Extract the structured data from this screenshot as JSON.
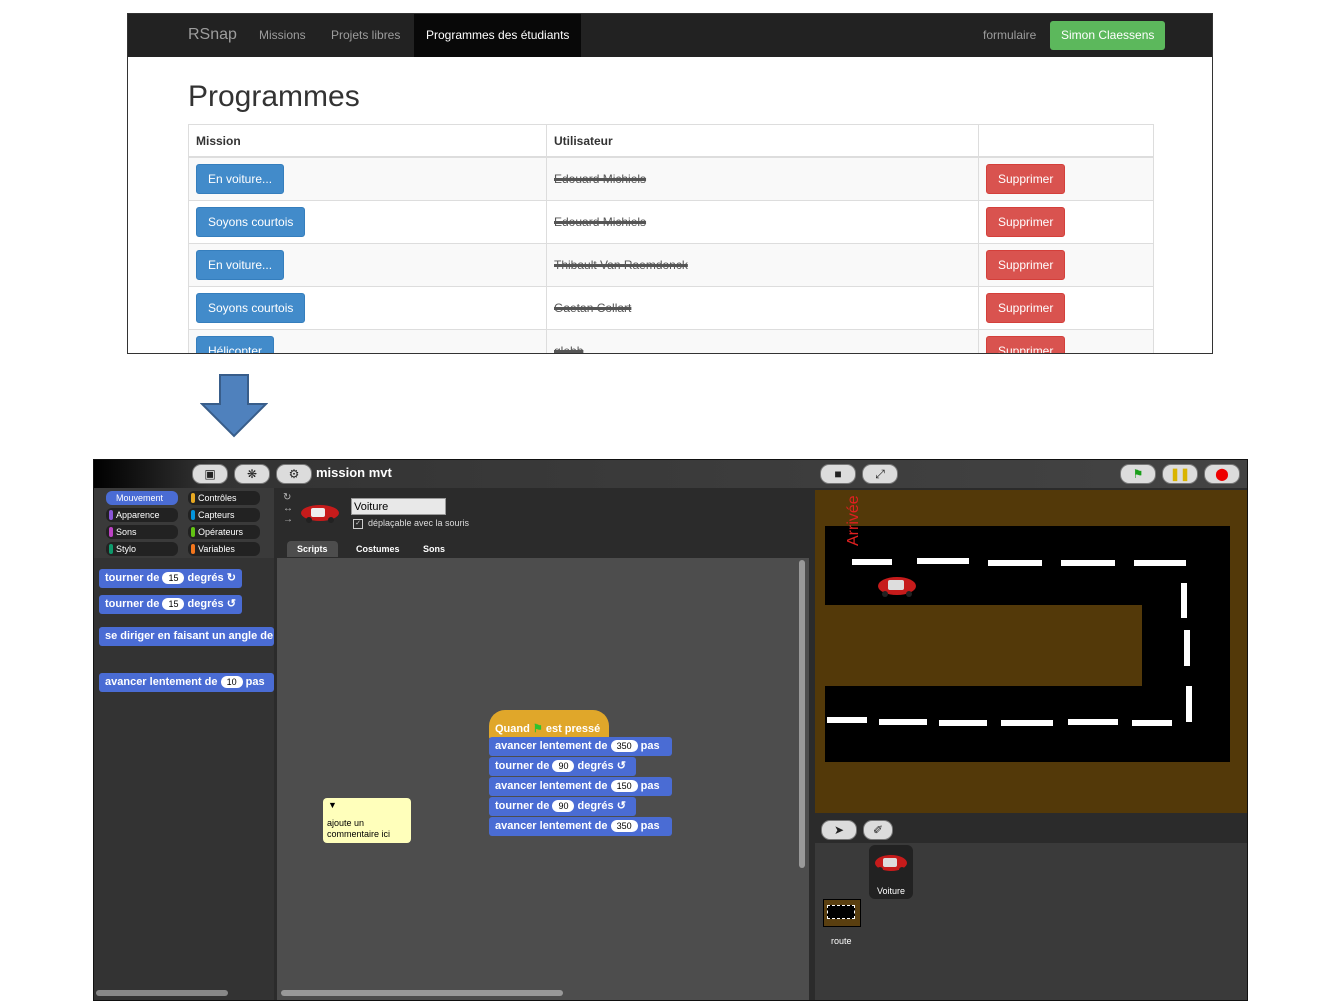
{
  "rsnap": {
    "brand": "RSnap",
    "nav": [
      "Missions",
      "Projets libres",
      "Programmes des étudiants"
    ],
    "right_link": "formulaire",
    "user_button": "Simon Claessens",
    "heading": "Programmes",
    "columns": [
      "Mission",
      "Utilisateur",
      ""
    ],
    "rows": [
      {
        "mission": "En voiture...",
        "user": "Edouard Michiels",
        "action": "Supprimer"
      },
      {
        "mission": "Soyons courtois",
        "user": "Edouard Michiels",
        "action": "Supprimer"
      },
      {
        "mission": "En voiture...",
        "user": "Thibault Van Raemdonck",
        "action": "Supprimer"
      },
      {
        "mission": "Soyons courtois",
        "user": "Gaetan Collart",
        "action": "Supprimer"
      },
      {
        "mission": "Hélicopter",
        "user": "glebb",
        "action": "Supprimer"
      }
    ]
  },
  "snap": {
    "project_title": "mission mvt",
    "categories": [
      "Mouvement",
      "Contrôles",
      "Apparence",
      "Capteurs",
      "Sons",
      "Opérateurs",
      "Stylo",
      "Variables"
    ],
    "category_colors": [
      "#4a6cd4",
      "#e6a822",
      "#8a55d7",
      "#0494dc",
      "#bb42c3",
      "#62c213",
      "#0e9a6c",
      "#f3761d"
    ],
    "palette": {
      "turn_right": {
        "label": "tourner de",
        "value": "15",
        "unit": "degrés"
      },
      "turn_left": {
        "label": "tourner de",
        "value": "15",
        "unit": "degrés"
      },
      "point": "se diriger en faisant un angle de",
      "move_slow": {
        "label": "avancer lentement de",
        "value": "10",
        "unit": "pas"
      }
    },
    "sprite_name": "Voiture",
    "draggable_label": "déplaçable avec la souris",
    "tabs": [
      "Scripts",
      "Costumes",
      "Sons"
    ],
    "hat": {
      "before": "Quand",
      "after": "est pressé"
    },
    "script": [
      {
        "label": "avancer lentement de",
        "value": "350",
        "unit": "pas"
      },
      {
        "label": "tourner de",
        "value": "90",
        "unit": "degrés"
      },
      {
        "label": "avancer lentement de",
        "value": "150",
        "unit": "pas"
      },
      {
        "label": "tourner de",
        "value": "90",
        "unit": "degrés"
      },
      {
        "label": "avancer lentement de",
        "value": "350",
        "unit": "pas"
      }
    ],
    "comment": "ajoute un commentaire ici",
    "stage_text": "Arrivée",
    "corral": {
      "sprite": "Voiture",
      "stage": "route"
    }
  }
}
